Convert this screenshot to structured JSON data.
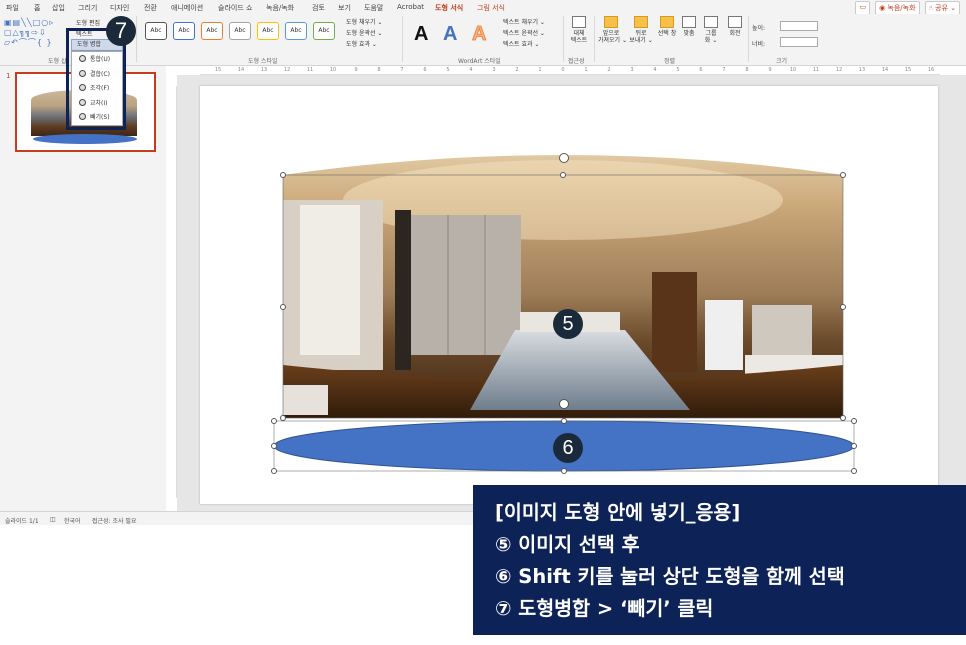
{
  "menu": {
    "tabs": [
      "파일",
      "홈",
      "삽입",
      "그리기",
      "디자인",
      "전환",
      "애니메이션",
      "슬라이드 쇼",
      "녹음/녹화",
      "검토",
      "보기",
      "도움말",
      "Acrobat",
      "도형 서식",
      "그림 서식"
    ],
    "active_tab": "도형 서식",
    "comment_label": "▭",
    "record_label": "◉ 녹음/녹화",
    "share_label": "☝ 공유 ⌄"
  },
  "ribbon": {
    "groups": {
      "insert_shapes": "도형 삽",
      "shape_styles": "도형 스타일",
      "wordart": "WordArt 스타일",
      "accessibility": "접근성",
      "arrange": "정렬",
      "size": "크기"
    },
    "edit_shape": "도형 편집",
    "merge_shapes": "도형 병합",
    "text_box": "텍스트",
    "style_sample": "Abc",
    "style_colors": [
      "#555555",
      "#4472c4",
      "#ed7d31",
      "#a5a5a5",
      "#ffc000",
      "#5b9bd5",
      "#70ad47"
    ],
    "shape_fill": "도형 채우기 ⌄",
    "shape_outline": "도형 윤곽선 ⌄",
    "shape_effects": "도형 효과 ⌄",
    "text_fill": "텍스트 채우기 ⌄",
    "text_outline": "텍스트 윤곽선 ⌄",
    "text_effects": "텍스트 효과 ⌄",
    "wordart_sample": "A",
    "alt_text": "대체\n텍스트",
    "arrange_buttons": [
      "앞으로\n가져오기 ⌄",
      "뒤로\n보내기 ⌄",
      "선택 창",
      "맞춤",
      "그룹\n화 ⌄",
      "회전"
    ],
    "height_label": "높이:",
    "width_label": "너비:"
  },
  "merge_menu": {
    "items": [
      "통합(U)",
      "결합(C)",
      "조각(F)",
      "교차(I)",
      "빼기(S)"
    ]
  },
  "thumbnail": {
    "number": "1"
  },
  "slide": {
    "badge_image": "5",
    "badge_ellipse": "6",
    "ellipse_color": "#4472c4"
  },
  "callout": {
    "number": "7"
  },
  "status": {
    "slide_count": "슬라이드 1/1",
    "language": "한국어",
    "accessibility": "접근성: 조사 필요"
  },
  "instruction": {
    "title": "[이미지 도형 안에 넣기_응용]",
    "step5": "⑤ 이미지 선택 후",
    "step6": "⑥ Shift 키를 눌러 상단 도형을 함께 선택",
    "step7": "⑦ 도형병합 > ‘빼기’ 클릭"
  }
}
